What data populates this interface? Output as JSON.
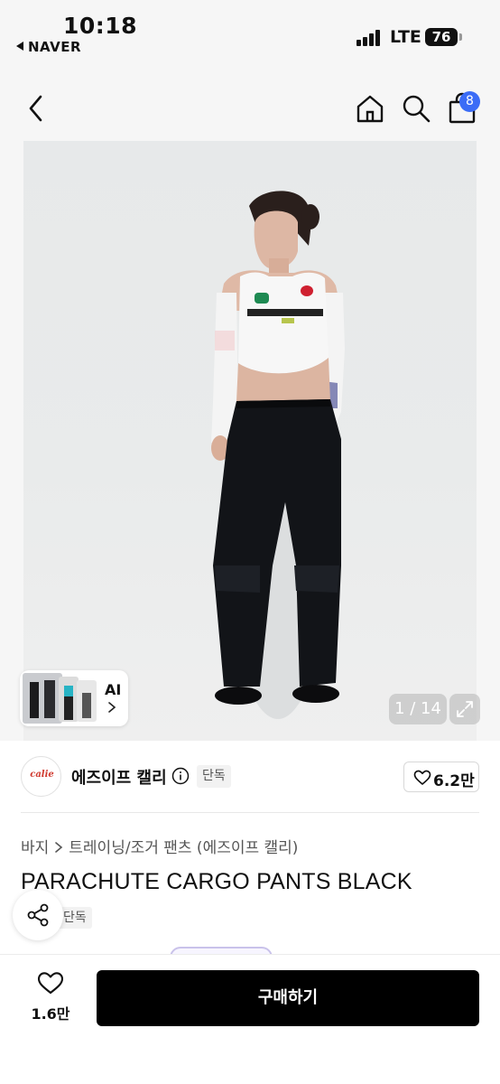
{
  "status_bar": {
    "time": "10:18",
    "back_app": "NAVER",
    "network": "LTE",
    "battery": "76"
  },
  "nav": {
    "icons": [
      "chevron-left-icon",
      "home-icon",
      "search-icon",
      "shopping-bag-icon"
    ],
    "cart_count": "8"
  },
  "gallery": {
    "ai_label": "AI",
    "page_counter": "1 / 14"
  },
  "brand": {
    "logo_text": "calie",
    "name": "에즈이프 캘리",
    "tag": "단독",
    "likes": "6.2만"
  },
  "product": {
    "breadcrumb": [
      "바지",
      "트레이닝/조거 팬츠 (에즈이프 캘리)"
    ],
    "title": "PARACHUTE CARGO PANTS BLACK",
    "tag": "단독"
  },
  "bottom_bar": {
    "wish_count": "1.6만",
    "buy_label": "구매하기"
  },
  "colors": {
    "accent": "#3b6cf6",
    "buy_button": "#000000",
    "brand_logo": "#d03a2f"
  }
}
